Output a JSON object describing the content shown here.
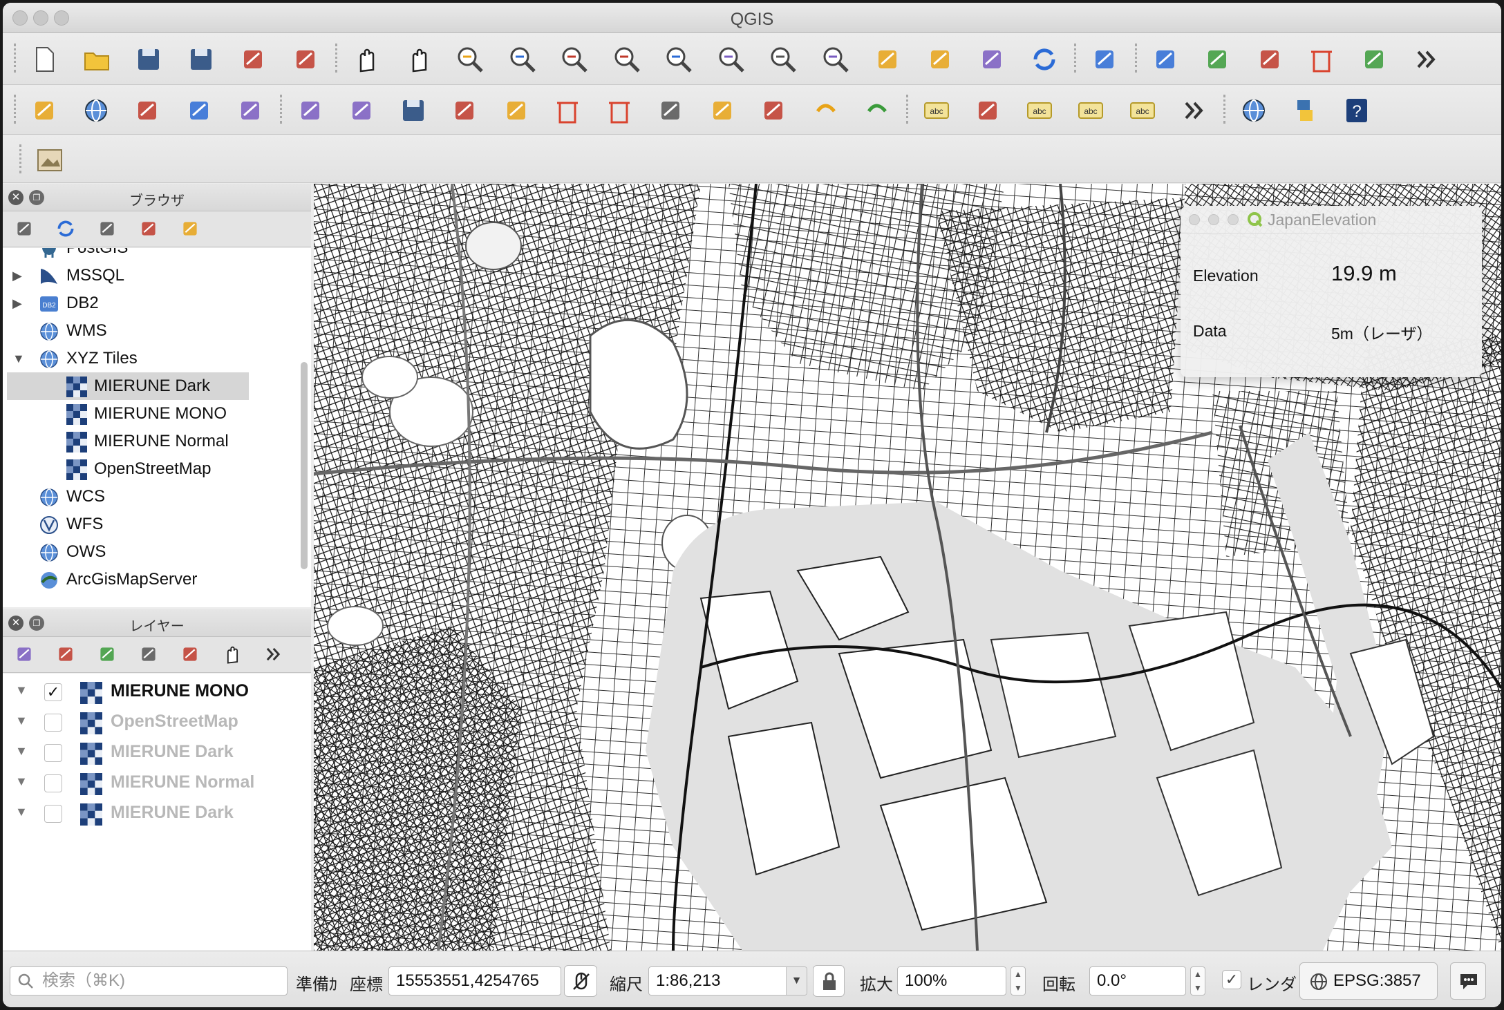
{
  "window": {
    "title": "QGIS"
  },
  "toolbar1": {
    "icons": [
      "new-project-icon",
      "open-project-icon",
      "save-project-icon",
      "save-as-icon",
      "new-print-layout-icon",
      "style-manager-icon",
      "pan-icon",
      "pan-to-selection-icon",
      "zoom-in-icon",
      "zoom-out-icon",
      "zoom-native-icon",
      "zoom-full-icon",
      "zoom-to-selection-icon",
      "zoom-to-layer-icon",
      "zoom-last-icon",
      "zoom-next-icon",
      "new-bookmark-icon",
      "show-bookmarks-icon",
      "new-map-view-icon",
      "refresh-icon",
      "identify-icon",
      "run-action-icon",
      "select-features-icon",
      "select-by-expression-icon",
      "deselect-icon",
      "open-attribute-table-icon",
      "overflow-icon"
    ]
  },
  "toolbar2": {
    "icons": [
      "add-vector-layer-icon",
      "add-raster-layer-icon",
      "add-delimited-text-icon",
      "add-spatialite-icon",
      "add-virtual-layer-icon",
      "current-edits-icon",
      "toggle-editing-icon",
      "save-layer-edits-icon",
      "digitize-icon",
      "vertex-tool-icon",
      "delete-part-icon",
      "delete-selected-icon",
      "cut-features-icon",
      "copy-features-icon",
      "paste-features-icon",
      "undo-icon",
      "redo-icon",
      "label-toolbar-icon",
      "diagram-icon",
      "highlight-labels-icon",
      "pin-labels-icon",
      "show-labels-icon",
      "overflow-icon",
      "metasearch-icon",
      "python-console-icon",
      "help-icon"
    ]
  },
  "toolbar3": {
    "icons": [
      "image-icon"
    ]
  },
  "browser": {
    "title": "ブラウザ",
    "tools": [
      "add-selected-layers-icon",
      "refresh-icon",
      "filter-icon",
      "collapse-all-icon",
      "properties-icon"
    ],
    "items": [
      {
        "label": "PostGIS",
        "icon": "postgis-icon",
        "level": 0,
        "arrow": ""
      },
      {
        "label": "MSSQL",
        "icon": "mssql-icon",
        "level": 0,
        "arrow": "▶"
      },
      {
        "label": "DB2",
        "icon": "db2-icon",
        "level": 0,
        "arrow": "▶"
      },
      {
        "label": "WMS",
        "icon": "wms-globe-icon",
        "level": 0,
        "arrow": ""
      },
      {
        "label": "XYZ Tiles",
        "icon": "xyz-globe-icon",
        "level": 0,
        "arrow": "▼"
      },
      {
        "label": "MIERUNE Dark",
        "icon": "tile-icon",
        "level": 1,
        "arrow": "",
        "selected": true
      },
      {
        "label": "MIERUNE MONO",
        "icon": "tile-icon",
        "level": 1,
        "arrow": ""
      },
      {
        "label": "MIERUNE Normal",
        "icon": "tile-icon",
        "level": 1,
        "arrow": ""
      },
      {
        "label": "OpenStreetMap",
        "icon": "tile-icon",
        "level": 1,
        "arrow": ""
      },
      {
        "label": "WCS",
        "icon": "wcs-globe-icon",
        "level": 0,
        "arrow": ""
      },
      {
        "label": "WFS",
        "icon": "wfs-icon",
        "level": 0,
        "arrow": ""
      },
      {
        "label": "OWS",
        "icon": "ows-globe-icon",
        "level": 0,
        "arrow": ""
      },
      {
        "label": "ArcGisMapServer",
        "icon": "arcgis-icon",
        "level": 0,
        "arrow": ""
      }
    ]
  },
  "layers": {
    "title": "レイヤー",
    "tools": [
      "style-layer-icon",
      "add-group-icon",
      "manage-visibility-icon",
      "filter-legend-icon",
      "filter-by-expression-icon",
      "expand-all-icon",
      "overflow-icon"
    ],
    "items": [
      {
        "label": "MIERUNE MONO",
        "checked": true
      },
      {
        "label": "OpenStreetMap",
        "checked": false
      },
      {
        "label": "MIERUNE Dark",
        "checked": false
      },
      {
        "label": "MIERUNE Normal",
        "checked": false
      },
      {
        "label": "MIERUNE Dark",
        "checked": false
      }
    ]
  },
  "popup": {
    "title": "JapanElevation",
    "elevation_label": "Elevation",
    "elevation_value": "19.9 m",
    "data_label": "Data",
    "data_value": "5m（レーザ）"
  },
  "status": {
    "search_placeholder": "検索（⌘K)",
    "ready_label": "準備ｶ",
    "coord_label": "座標",
    "coord_value": "15553551,4254765",
    "scale_label": "縮尺",
    "scale_value": "1:86,213",
    "magnify_label": "拡大",
    "magnify_value": "100%",
    "rotation_label": "回転",
    "rotation_value": "0.0°",
    "render_label": "レンダ",
    "crs_value": "EPSG:3857"
  },
  "colors": {
    "accent": "#2b6bd6",
    "map_bg": "#f4f4f4",
    "tile_blue": "#1d3f7a"
  }
}
